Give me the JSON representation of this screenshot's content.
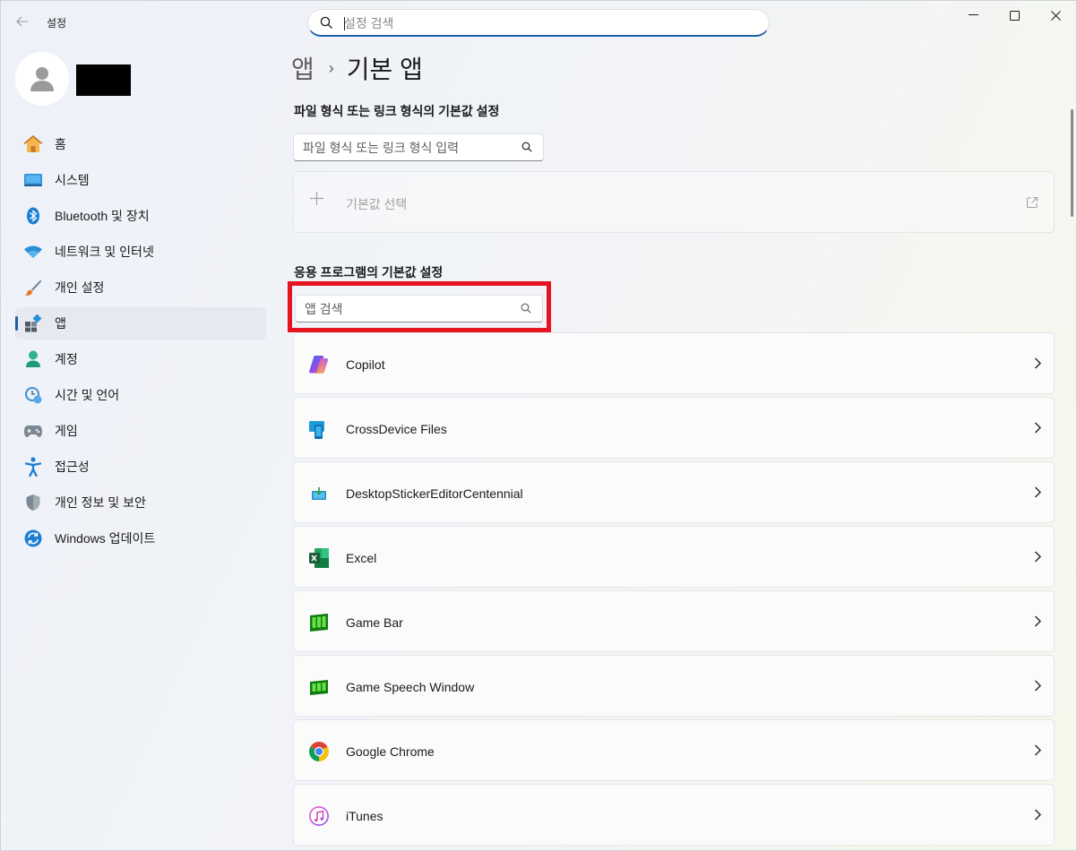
{
  "window": {
    "app_title": "설정",
    "search_placeholder": "설정 검색"
  },
  "sidebar": {
    "items": [
      {
        "label": "홈",
        "icon": "home-icon"
      },
      {
        "label": "시스템",
        "icon": "system-icon"
      },
      {
        "label": "Bluetooth 및 장치",
        "icon": "bluetooth-icon"
      },
      {
        "label": "네트워크 및 인터넷",
        "icon": "wifi-icon"
      },
      {
        "label": "개인 설정",
        "icon": "brush-icon"
      },
      {
        "label": "앱",
        "icon": "apps-icon",
        "selected": true
      },
      {
        "label": "계정",
        "icon": "account-icon"
      },
      {
        "label": "시간 및 언어",
        "icon": "time-language-icon"
      },
      {
        "label": "게임",
        "icon": "gamepad-icon"
      },
      {
        "label": "접근성",
        "icon": "accessibility-icon"
      },
      {
        "label": "개인 정보 및 보안",
        "icon": "shield-icon"
      },
      {
        "label": "Windows 업데이트",
        "icon": "update-icon"
      }
    ]
  },
  "breadcrumb": {
    "parent": "앱",
    "separator": "›",
    "current": "기본 앱"
  },
  "file_types": {
    "title": "파일 형식 또는 링크 형식의 기본값 설정",
    "input_placeholder": "파일 형식 또는 링크 형식 입력",
    "choose_default_label": "기본값 선택"
  },
  "apps_section": {
    "title": "응용 프로그램의 기본값 설정",
    "search_placeholder": "앱 검색",
    "highlight_color": "#e5141f",
    "apps": [
      {
        "name": "Copilot",
        "icon": "copilot-icon"
      },
      {
        "name": "CrossDevice Files",
        "icon": "crossdevice-icon"
      },
      {
        "name": "DesktopStickerEditorCentennial",
        "icon": "sticker-editor-icon"
      },
      {
        "name": "Excel",
        "icon": "excel-icon"
      },
      {
        "name": "Game Bar",
        "icon": "gamebar-icon"
      },
      {
        "name": "Game Speech Window",
        "icon": "game-speech-icon"
      },
      {
        "name": "Google Chrome",
        "icon": "chrome-icon"
      },
      {
        "name": "iTunes",
        "icon": "itunes-icon"
      }
    ]
  },
  "colors": {
    "accent": "#1f5fa8"
  }
}
